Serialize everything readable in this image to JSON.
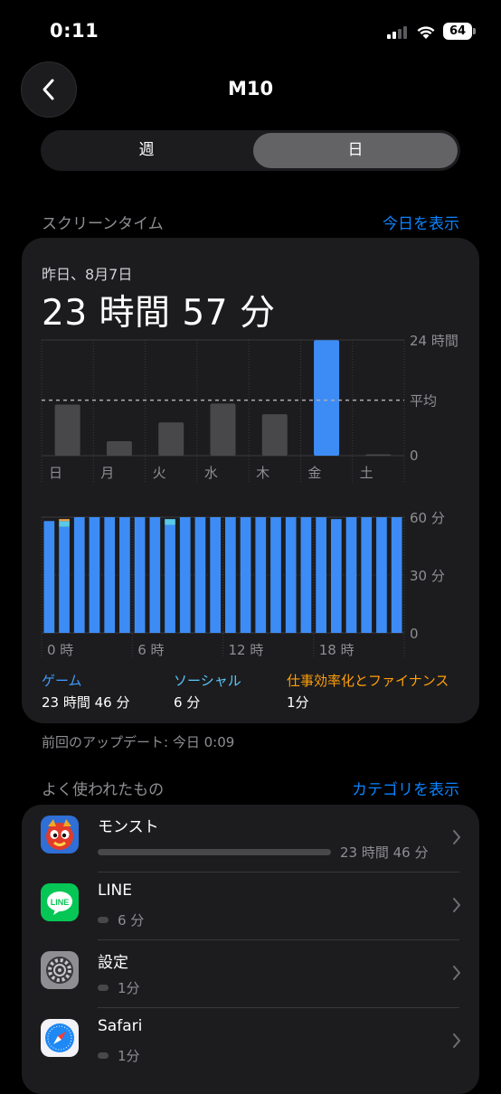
{
  "status_bar": {
    "time": "0:11",
    "battery": "64"
  },
  "nav": {
    "title": "M10"
  },
  "segments": {
    "week": "週",
    "day": "日"
  },
  "screen_time_section": {
    "title": "スクリーンタイム",
    "link": "今日を表示"
  },
  "summary": {
    "date": "昨日、8月7日",
    "total": "23 時間 57 分"
  },
  "chart_data": [
    {
      "type": "bar",
      "categories": [
        "日",
        "月",
        "火",
        "水",
        "木",
        "金",
        "土"
      ],
      "values": [
        10.6,
        3.0,
        6.9,
        10.8,
        8.6,
        23.95,
        0.1
      ],
      "highlight_index": 5,
      "average": 11.5,
      "average_label": "平均",
      "ylim": [
        0,
        24
      ],
      "y_ticks": [
        "24 時間",
        "0"
      ]
    },
    {
      "type": "bar",
      "stacked": true,
      "x_tick_labels": [
        "0 時",
        "6 時",
        "12 時",
        "18 時"
      ],
      "ylim": [
        0,
        60
      ],
      "y_ticks": [
        "60 分",
        "30 分",
        "0"
      ],
      "series": [
        {
          "name": "ゲーム",
          "color": "#3d8cf5",
          "values": [
            58,
            55,
            60,
            60,
            60,
            60,
            60,
            60,
            56,
            60,
            60,
            60,
            60,
            60,
            60,
            60,
            60,
            60,
            60,
            59,
            60,
            60,
            60,
            60
          ]
        },
        {
          "name": "ソーシャル",
          "color": "#5ac8e8",
          "values": [
            0,
            3,
            0,
            0,
            0,
            0,
            0,
            0,
            3,
            0,
            0,
            0,
            0,
            0,
            0,
            0,
            0,
            0,
            0,
            0,
            0,
            0,
            0,
            0
          ]
        },
        {
          "name": "仕事効率化とファイナンス",
          "color": "#f0a048",
          "values": [
            0,
            1,
            0,
            0,
            0,
            0,
            0,
            0,
            0,
            0,
            0,
            0,
            0,
            0,
            0,
            0,
            0,
            0,
            0,
            0,
            0,
            0,
            0,
            0
          ]
        }
      ]
    }
  ],
  "legend": [
    {
      "label": "ゲーム",
      "value": "23 時間 46 分",
      "color": "#409cff"
    },
    {
      "label": "ソーシャル",
      "value": "6 分",
      "color": "#5ac8fa"
    },
    {
      "label": "仕事効率化とファイナンス",
      "value": "1分",
      "color": "#ff9f0a"
    }
  ],
  "update_note": "前回のアップデート: 今日 0:09",
  "most_used_section": {
    "title": "よく使われたもの",
    "link": "カテゴリを表示"
  },
  "apps": [
    {
      "name": "モンスト",
      "duration": "23 時間 46 分",
      "usage_fraction": 1.0,
      "icon": "monst-icon"
    },
    {
      "name": "LINE",
      "duration": "6 分",
      "usage_fraction": 0.004,
      "icon": "line-icon"
    },
    {
      "name": "設定",
      "duration": "1分",
      "usage_fraction": 0.001,
      "icon": "settings-icon"
    },
    {
      "name": "Safari",
      "duration": "1分",
      "usage_fraction": 0.001,
      "icon": "safari-icon"
    }
  ]
}
